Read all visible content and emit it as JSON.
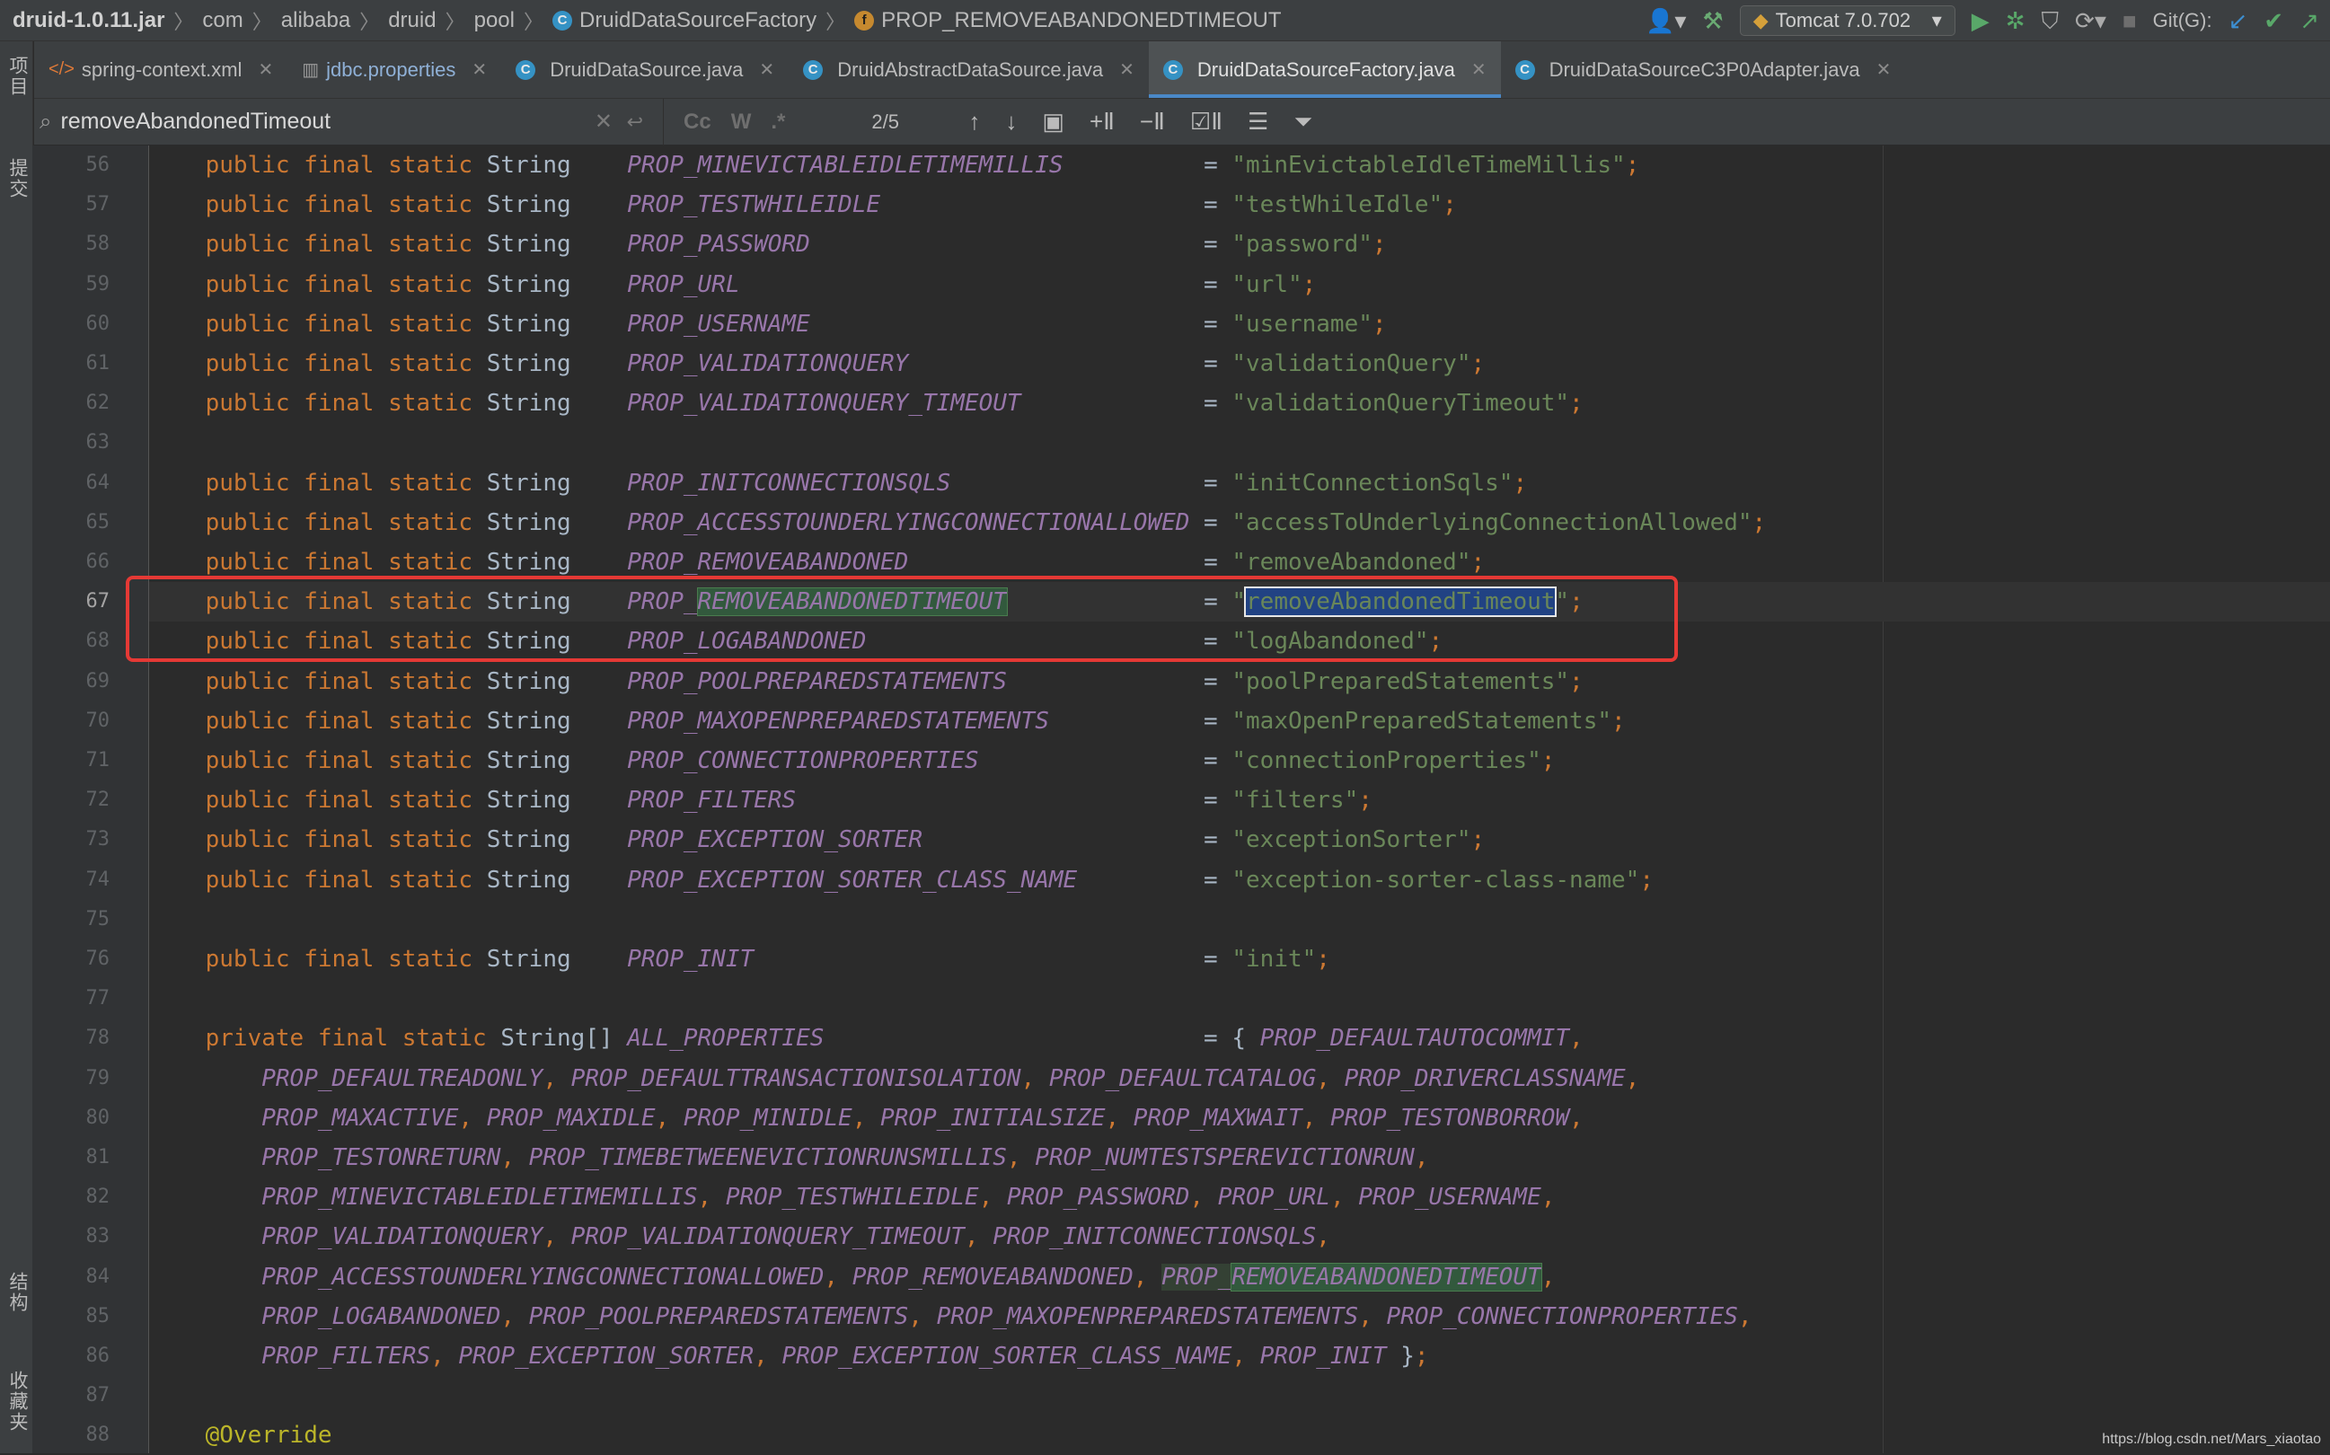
{
  "breadcrumb": {
    "items": [
      "druid-1.0.11.jar",
      "com",
      "alibaba",
      "druid",
      "pool",
      "DruidDataSourceFactory",
      "PROP_REMOVEABANDONEDTIMEOUT"
    ]
  },
  "toolbar": {
    "run_config": "Tomcat 7.0.702",
    "git_label": "Git(G):"
  },
  "tabs": [
    {
      "label": "spring-context.xml",
      "icon": "xml-icon",
      "active": false
    },
    {
      "label": "jdbc.properties",
      "icon": "properties-icon",
      "active": false
    },
    {
      "label": "DruidDataSource.java",
      "icon": "class-icon",
      "active": false
    },
    {
      "label": "DruidAbstractDataSource.java",
      "icon": "class-icon",
      "active": false
    },
    {
      "label": "DruidDataSourceFactory.java",
      "icon": "class-icon",
      "active": true
    },
    {
      "label": "DruidDataSourceC3P0Adapter.java",
      "icon": "class-icon",
      "active": false
    }
  ],
  "search": {
    "query": "removeAbandonedTimeout",
    "match_case": "Cc",
    "words": "W",
    "regex": ".*",
    "count": "2/5"
  },
  "sidebar": {
    "top_label": "项目",
    "commit_label": "提交",
    "structure_label": "结构",
    "favorites_label": "收藏夹"
  },
  "code": {
    "lines": [
      {
        "n": "56",
        "field": "PROP_MINEVICTABLEIDLETIMEMILLIS",
        "value": "\"minEvictableIdleTimeMillis\""
      },
      {
        "n": "57",
        "field": "PROP_TESTWHILEIDLE",
        "value": "\"testWhileIdle\""
      },
      {
        "n": "58",
        "field": "PROP_PASSWORD",
        "value": "\"password\""
      },
      {
        "n": "59",
        "field": "PROP_URL",
        "value": "\"url\""
      },
      {
        "n": "60",
        "field": "PROP_USERNAME",
        "value": "\"username\""
      },
      {
        "n": "61",
        "field": "PROP_VALIDATIONQUERY",
        "value": "\"validationQuery\""
      },
      {
        "n": "62",
        "field": "PROP_VALIDATIONQUERY_TIMEOUT",
        "value": "\"validationQueryTimeout\""
      },
      {
        "n": "63",
        "field": "",
        "value": ""
      },
      {
        "n": "64",
        "field": "PROP_INITCONNECTIONSQLS",
        "value": "\"initConnectionSqls\""
      },
      {
        "n": "65",
        "field": "PROP_ACCESSTOUNDERLYINGCONNECTIONALLOWED",
        "value": "\"accessToUnderlyingConnectionAllowed\""
      },
      {
        "n": "66",
        "field": "PROP_REMOVEABANDONED",
        "value": "\"removeAbandoned\""
      },
      {
        "n": "67",
        "field": "PROP_REMOVEABANDONEDTIMEOUT",
        "value": "\"removeAbandonedTimeout\""
      },
      {
        "n": "68",
        "field": "PROP_LOGABANDONED",
        "value": "\"logAbandoned\""
      },
      {
        "n": "69",
        "field": "PROP_POOLPREPAREDSTATEMENTS",
        "value": "\"poolPreparedStatements\""
      },
      {
        "n": "70",
        "field": "PROP_MAXOPENPREPAREDSTATEMENTS",
        "value": "\"maxOpenPreparedStatements\""
      },
      {
        "n": "71",
        "field": "PROP_CONNECTIONPROPERTIES",
        "value": "\"connectionProperties\""
      },
      {
        "n": "72",
        "field": "PROP_FILTERS",
        "value": "\"filters\""
      },
      {
        "n": "73",
        "field": "PROP_EXCEPTION_SORTER",
        "value": "\"exceptionSorter\""
      },
      {
        "n": "74",
        "field": "PROP_EXCEPTION_SORTER_CLASS_NAME",
        "value": "\"exception-sorter-class-name\""
      },
      {
        "n": "75",
        "field": "",
        "value": ""
      },
      {
        "n": "76",
        "field": "PROP_INIT",
        "value": "\"init\""
      },
      {
        "n": "77",
        "field": "",
        "value": ""
      }
    ],
    "decl_prefix": "public final static String",
    "array_line": {
      "n": "78",
      "prefix": "private final static String[]",
      "name": "ALL_PROPERTIES",
      "tail": "PROP_DEFAULTAUTOCOMMIT,"
    },
    "cont_lines": [
      {
        "n": "79",
        "text": "PROP_DEFAULTREADONLY, PROP_DEFAULTTRANSACTIONISOLATION, PROP_DEFAULTCATALOG, PROP_DRIVERCLASSNAME,"
      },
      {
        "n": "80",
        "text": "PROP_MAXACTIVE, PROP_MAXIDLE, PROP_MINIDLE, PROP_INITIALSIZE, PROP_MAXWAIT, PROP_TESTONBORROW,"
      },
      {
        "n": "81",
        "text": "PROP_TESTONRETURN, PROP_TIMEBETWEENEVICTIONRUNSMILLIS, PROP_NUMTESTSPEREVICTIONRUN,"
      },
      {
        "n": "82",
        "text": "PROP_MINEVICTABLEIDLETIMEMILLIS, PROP_TESTWHILEIDLE, PROP_PASSWORD, PROP_URL, PROP_USERNAME,"
      },
      {
        "n": "83",
        "text": "PROP_VALIDATIONQUERY, PROP_VALIDATIONQUERY_TIMEOUT, PROP_INITCONNECTIONSQLS,"
      },
      {
        "n": "84",
        "text": "PROP_ACCESSTOUNDERLYINGCONNECTIONALLOWED, PROP_REMOVEABANDONED, PROP_REMOVEABANDONEDTIMEOUT,"
      },
      {
        "n": "85",
        "text": "PROP_LOGABANDONED, PROP_POOLPREPAREDSTATEMENTS, PROP_MAXOPENPREPAREDSTATEMENTS, PROP_CONNECTIONPROPERTIES,"
      },
      {
        "n": "86",
        "text": "PROP_FILTERS, PROP_EXCEPTION_SORTER, PROP_EXCEPTION_SORTER_CLASS_NAME, PROP_INIT };"
      }
    ],
    "blank_line": {
      "n": "87"
    },
    "annotation_line": {
      "n": "88",
      "text": "@Override"
    }
  },
  "watermark": "https://blog.csdn.net/Mars_xiaotao",
  "colors": {
    "keyword": "#cc7832",
    "field": "#9876aa",
    "string": "#6a8759",
    "highlight_box": "#e53935"
  }
}
